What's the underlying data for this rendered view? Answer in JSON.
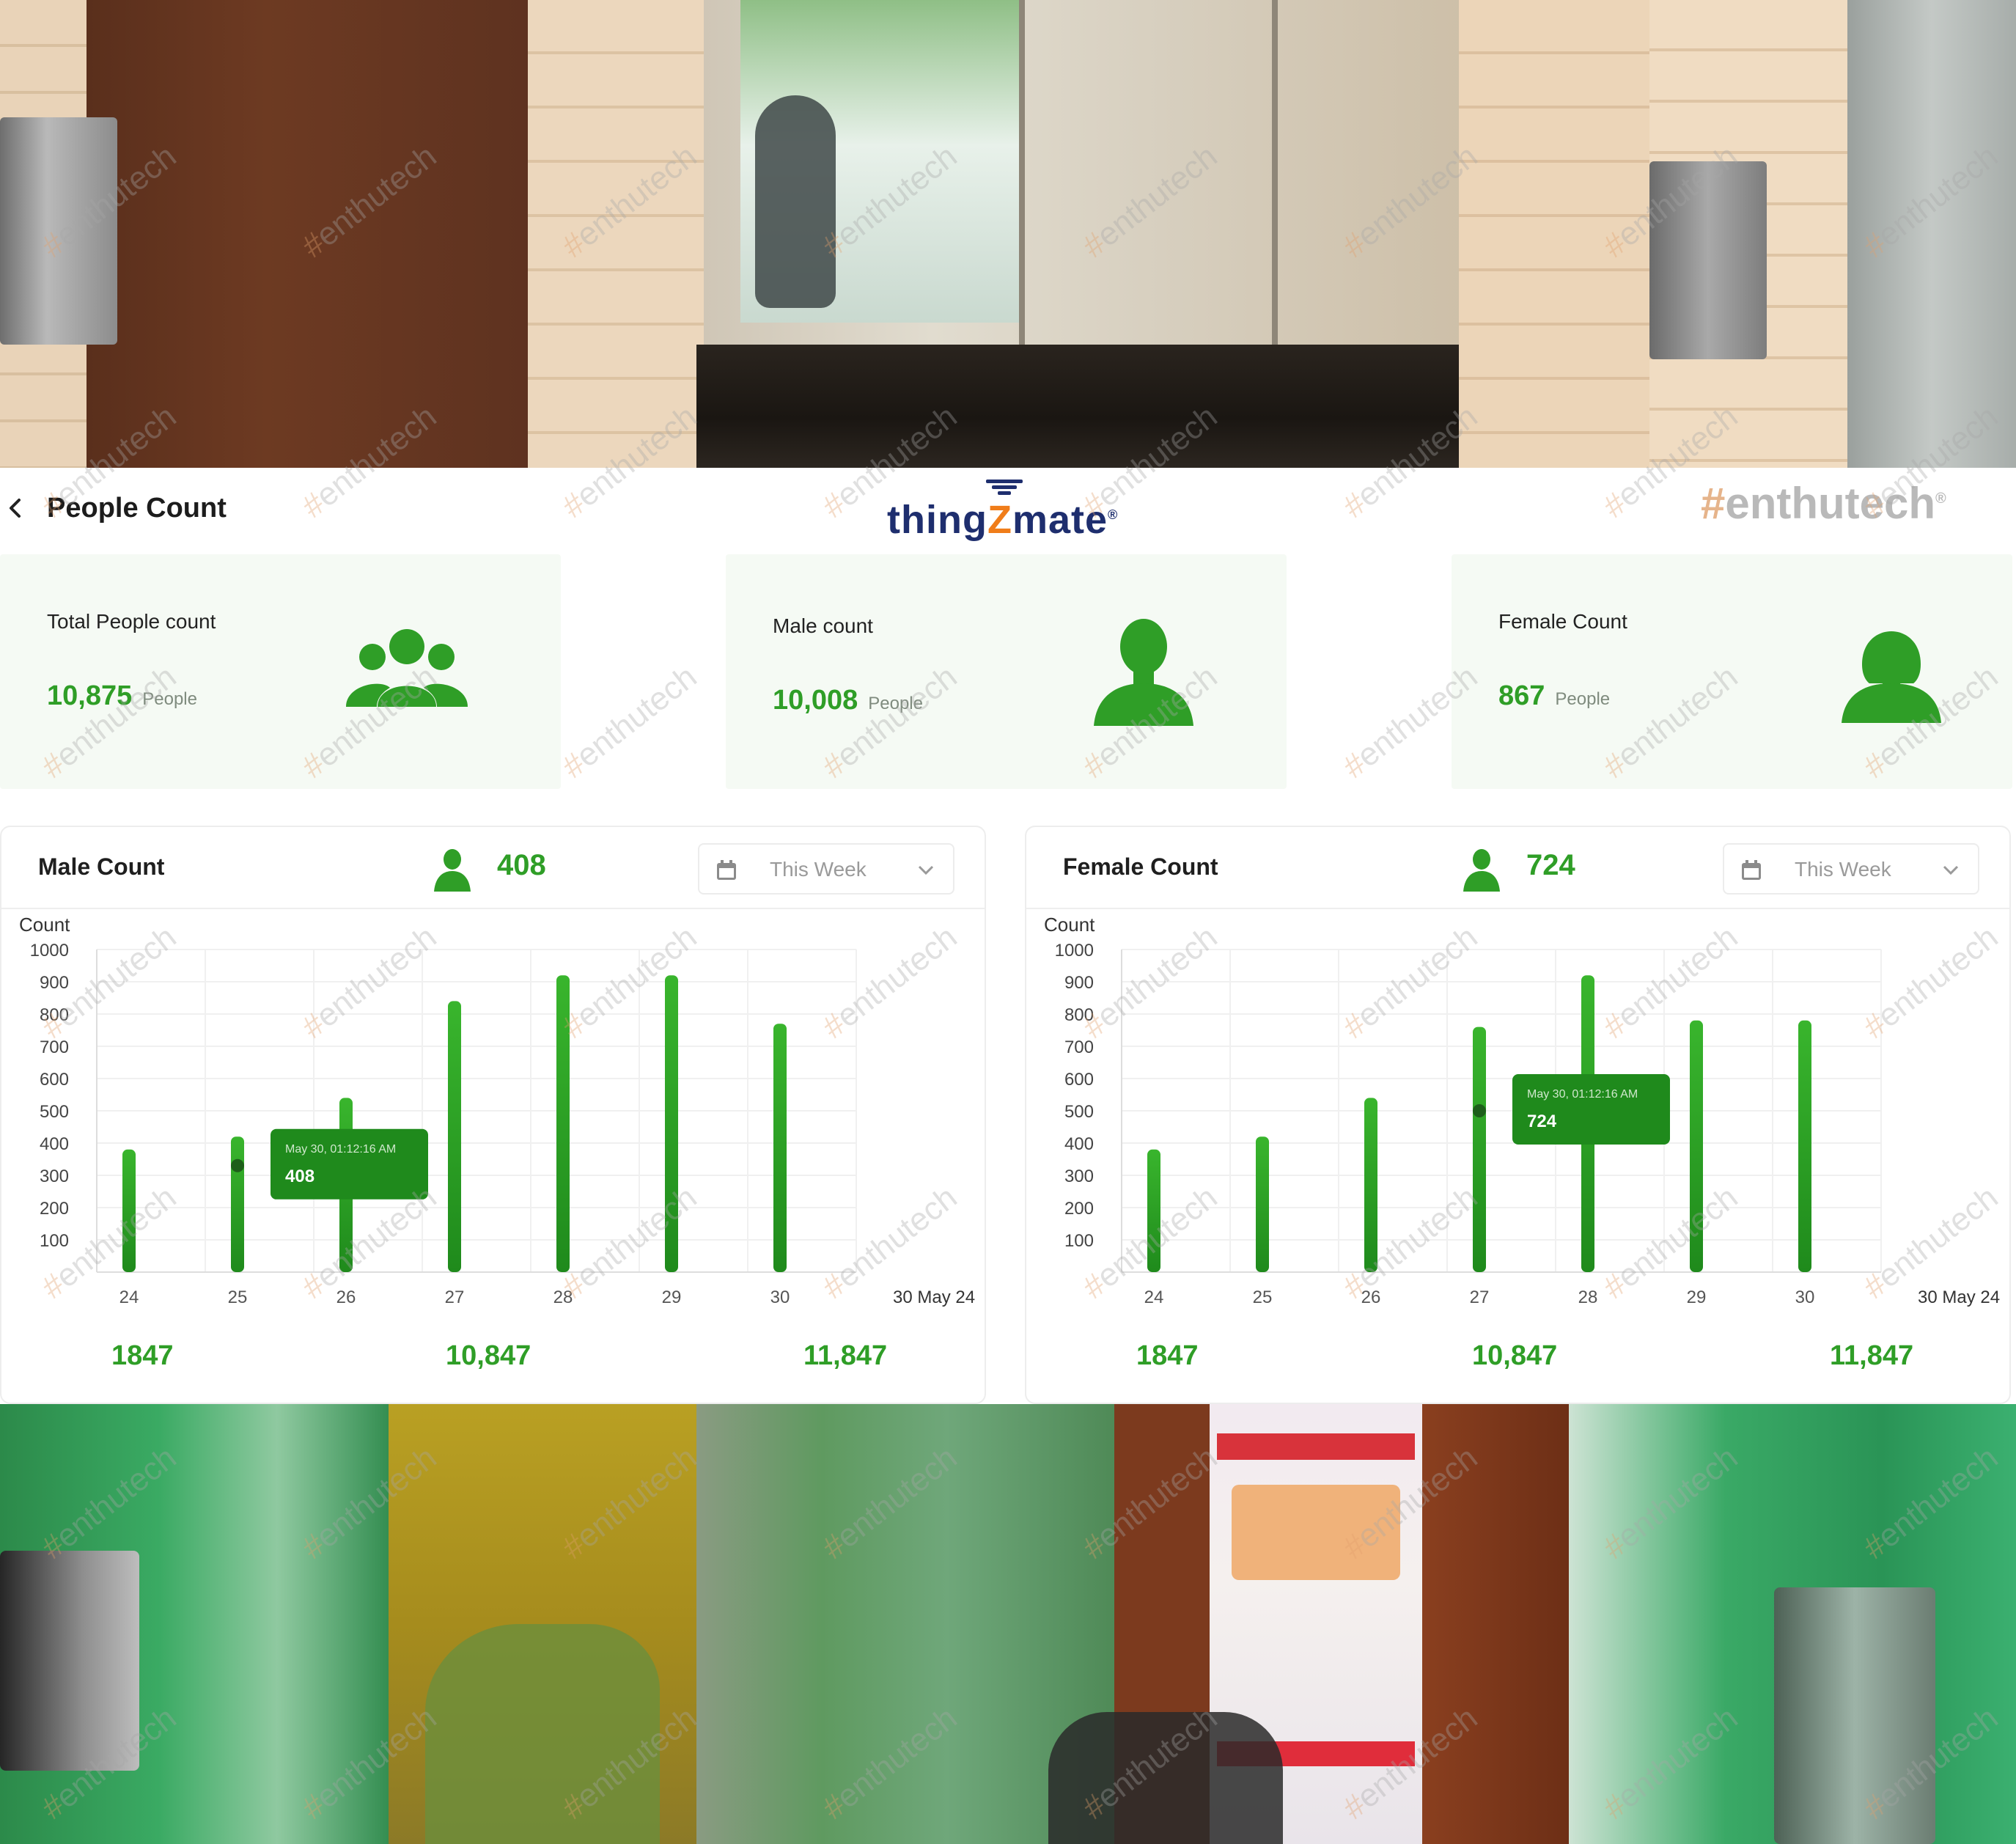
{
  "header": {
    "back_icon": "chevron-left-icon",
    "title": "People Count",
    "logo": "thingZmate",
    "brand": "#enthutech"
  },
  "stats": [
    {
      "label": "Total People count",
      "value": "10,875",
      "unit": "People",
      "icon": "group-icon"
    },
    {
      "label": "Male count",
      "value": "10,008",
      "unit": "People",
      "icon": "male-user-icon"
    },
    {
      "label": "Female Count",
      "value": "867",
      "unit": "People",
      "icon": "female-user-icon"
    }
  ],
  "panels": [
    {
      "title": "Male Count",
      "count": "408",
      "period": "This Week",
      "totals": [
        "1847",
        "10,847",
        "11,847"
      ],
      "tooltip": {
        "date": "May 30, 01:12:16 AM",
        "value": "408"
      }
    },
    {
      "title": "Female Count",
      "count": "724",
      "period": "This Week",
      "totals": [
        "1847",
        "10,847",
        "11,847"
      ],
      "tooltip": {
        "date": "May 30, 01:12:16 AM",
        "value": "724"
      }
    }
  ],
  "chart_data": [
    {
      "type": "bar",
      "ylabel": "Count",
      "ylim": [
        0,
        1000
      ],
      "yticks": [
        100,
        200,
        300,
        400,
        500,
        600,
        700,
        800,
        900,
        1000
      ],
      "categories": [
        "24",
        "25",
        "26",
        "27",
        "28",
        "29",
        "30"
      ],
      "x_end_label": "30 May 24",
      "values": [
        380,
        420,
        540,
        840,
        920,
        920,
        770
      ],
      "highlight_index": 1,
      "highlight_value": 330,
      "color": "#2f9e27"
    },
    {
      "type": "bar",
      "ylabel": "Count",
      "ylim": [
        0,
        1000
      ],
      "yticks": [
        100,
        200,
        300,
        400,
        500,
        600,
        700,
        800,
        900,
        1000
      ],
      "categories": [
        "24",
        "25",
        "26",
        "27",
        "28",
        "29",
        "30"
      ],
      "x_end_label": "30 May 24",
      "values": [
        380,
        420,
        540,
        760,
        920,
        780,
        780
      ],
      "highlight_index": 3,
      "highlight_value": 500,
      "color": "#2f9e27"
    }
  ],
  "watermark": "enthutech"
}
